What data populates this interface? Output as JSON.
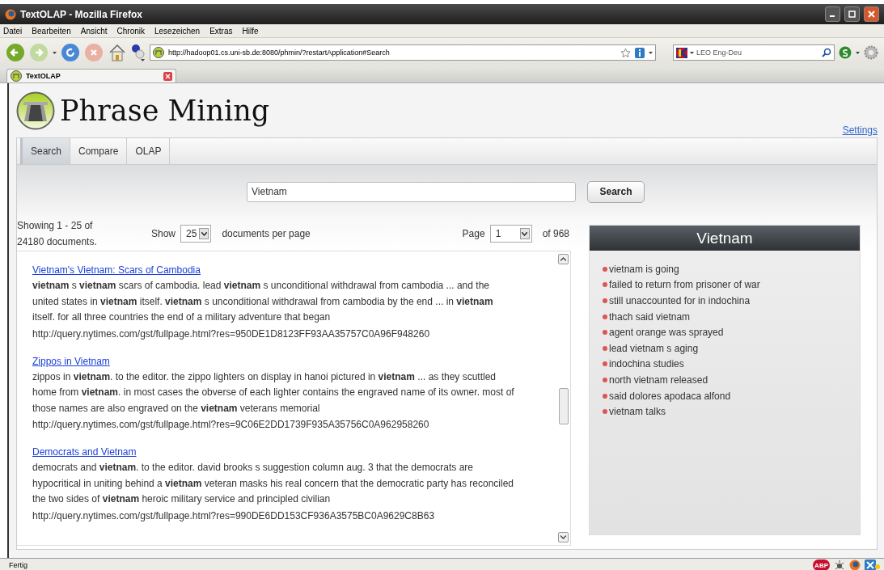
{
  "window": {
    "title": "TextOLAP - Mozilla Firefox"
  },
  "menu": [
    "Datei",
    "Bearbeiten",
    "Ansicht",
    "Chronik",
    "Lesezeichen",
    "Extras",
    "Hilfe"
  ],
  "toolbar": {
    "url": "http://hadoop01.cs.uni-sb.de:8080/phmin/?restartApplication#Search",
    "search_engine": "LEO Eng-Deu"
  },
  "browser_tabs": [
    {
      "label": "TextOLAP",
      "selected": true
    }
  ],
  "page": {
    "logo_title": "Phrase Mining",
    "settings_link": "Settings",
    "tabs": [
      {
        "label": "Search",
        "selected": true
      },
      {
        "label": "Compare",
        "selected": false
      },
      {
        "label": "OLAP",
        "selected": false
      }
    ],
    "search": {
      "value": "Vietnam",
      "button": "Search"
    },
    "summary": "Showing 1 - 25 of 24180 documents.",
    "show_label": "Show",
    "per_page": "25",
    "per_page_label": "documents per page",
    "page_label": "Page",
    "page_number": "1",
    "page_count": "of 968",
    "results": [
      {
        "title": "Vietnam's Vietnam: Scars of Cambodia",
        "snippet": "**vietnam** s **vietnam** scars of cambodia. lead **vietnam** s unconditional withdrawal from cambodia ... and the united states in **vietnam** itself. **vietnam** s unconditional withdrawal from cambodia by the end ... in **vietnam** itself. for all three countries the end of a military adventure that began",
        "url": "http://query.nytimes.com/gst/fullpage.html?res=950DE1D8123FF93AA35757C0A96F948260"
      },
      {
        "title": "Zippos in Vietnam",
        "snippet": "zippos in **vietnam**. to the editor. the zippo lighters on display in hanoi pictured in **vietnam** ... as they scuttled home from **vietnam**. in most cases the obverse of each lighter contains the engraved name of its owner. most of those names are also engraved on the **vietnam** veterans memorial",
        "url": "http://query.nytimes.com/gst/fullpage.html?res=9C06E2DD1739F935A35756C0A962958260"
      },
      {
        "title": "Democrats and Vietnam",
        "snippet": "democrats and **vietnam**. to the editor. david brooks s suggestion column aug. 3 that the democrats are hypocritical in uniting behind a **vietnam** veteran masks his real concern that the democratic party has reconciled the two sides of **vietnam** heroic military service and principled civilian",
        "url": "http://query.nytimes.com/gst/fullpage.html?res=990DE6DD153CF936A3575BC0A9629C8B63"
      }
    ],
    "phrases": {
      "title": "Vietnam",
      "items": [
        "vietnam is going",
        "failed to return from prisoner of war",
        "still unaccounted for in indochina",
        "thach said vietnam",
        "agent orange was sprayed",
        "lead vietnam s aging",
        "indochina studies",
        "north vietnam released",
        "said dolores apodaca alfond",
        "vietnam talks"
      ]
    }
  },
  "status_bar": {
    "text": "Fertig",
    "adblock_badge": "ABP"
  }
}
